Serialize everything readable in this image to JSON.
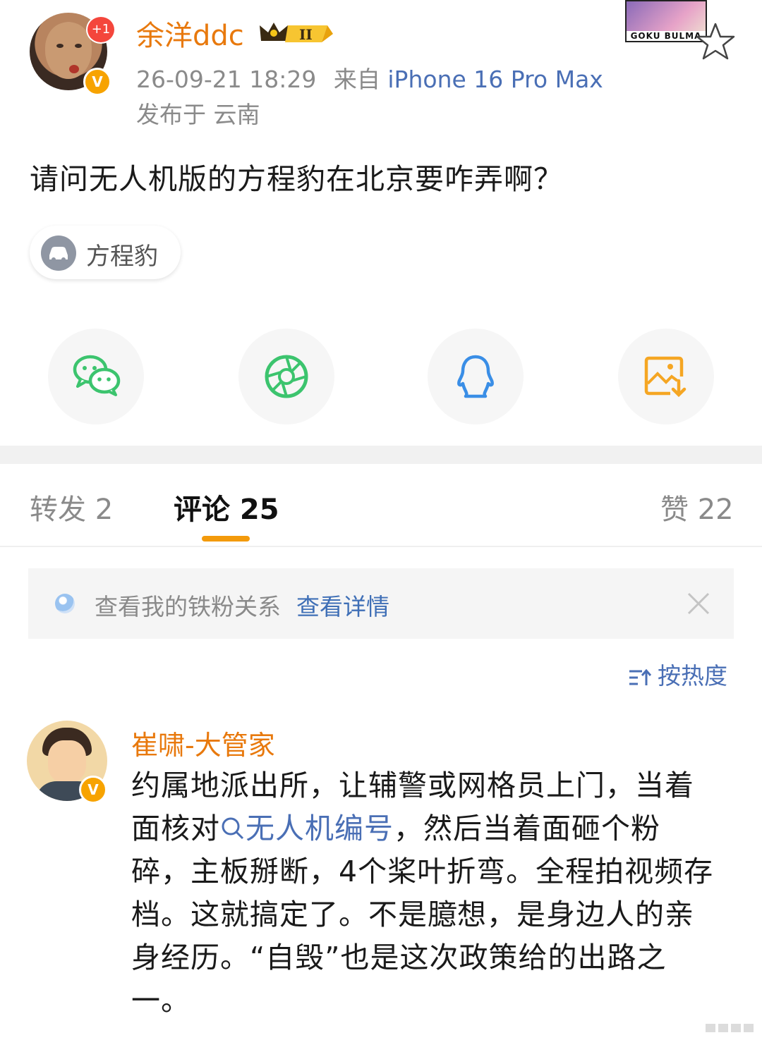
{
  "post": {
    "author": "余洋ddc",
    "notification_badge": "+1",
    "verified_mark": "V",
    "rank_badge": "II",
    "timestamp": "26-09-21 18:29",
    "source_prefix": "来自",
    "device": "iPhone 16 Pro Max",
    "location": "发布于 云南",
    "text": "请问无人机版的方程豹在北京要咋弄啊？",
    "topic": "方程豹",
    "sticker_text": "GOKU BULMA"
  },
  "share": {
    "items": [
      {
        "name": "wechat"
      },
      {
        "name": "moments"
      },
      {
        "name": "qq"
      },
      {
        "name": "save-image"
      }
    ]
  },
  "tabs": {
    "repost": "转发 2",
    "comments": "评论 25",
    "likes": "赞 22"
  },
  "fan_bar": {
    "text": "查看我的铁粉关系",
    "link": "查看详情"
  },
  "sort": {
    "label": "按热度"
  },
  "comment": {
    "author": "崔啸-大管家",
    "verified_mark": "V",
    "line1": "约属地派出所，让辅警或网格员上门，当着",
    "line2_a": "面核对",
    "keyword": "无人机编号",
    "line2_b": "，然后当着面砸个粉",
    "line3": "碎，主板掰断，4个桨叶折弯。全程拍视频存",
    "line4": "档。这就搞定了。不是臆想，是身边人的亲",
    "line5": "身经历。“自毁”也是这次政策给的出路之",
    "line6": "一。"
  },
  "colors": {
    "accent_orange": "#e8790d",
    "link_blue": "#4a6fb5",
    "tab_underline": "#f39a0b",
    "wechat_green": "#3cc46e",
    "qq_blue": "#3a8ee6",
    "save_orange": "#f5a623"
  }
}
